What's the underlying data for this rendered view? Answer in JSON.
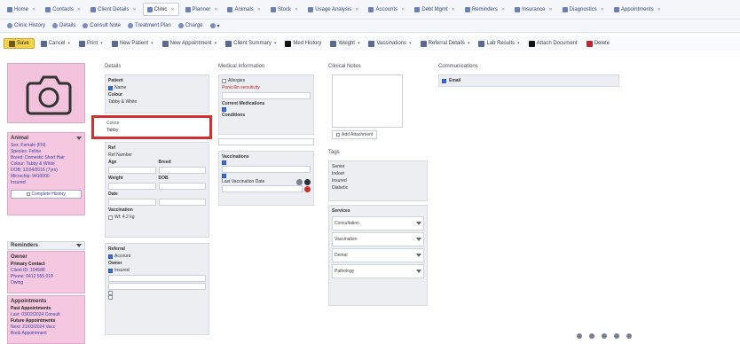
{
  "tabs": [
    {
      "label": "Home",
      "active": false
    },
    {
      "label": "Contacts",
      "active": false
    },
    {
      "label": "Client Details",
      "active": false
    },
    {
      "label": "Clinic",
      "active": true
    },
    {
      "label": "Planner",
      "active": false
    },
    {
      "label": "Animals",
      "active": false
    },
    {
      "label": "Stock",
      "active": false
    },
    {
      "label": "Usage Analysis",
      "active": false
    },
    {
      "label": "Accounts",
      "active": false
    },
    {
      "label": "Debt Mgmt",
      "active": false
    },
    {
      "label": "Reminders",
      "active": false
    },
    {
      "label": "Insurance",
      "active": false
    },
    {
      "label": "Diagnostics",
      "active": false
    },
    {
      "label": "Appointments",
      "active": false
    }
  ],
  "breadcrumbs": [
    "Clinic History",
    "Details",
    "Consult Note",
    "Treatment Plan",
    "Charge",
    "▾"
  ],
  "toolbar": [
    {
      "label": "Save",
      "kind": "save"
    },
    {
      "label": "Cancel",
      "kind": "dd"
    },
    {
      "label": "Print",
      "kind": "dd"
    },
    {
      "label": "New Patient",
      "kind": "dd"
    },
    {
      "label": "New Appointment",
      "kind": "dd"
    },
    {
      "label": "Client Summary",
      "kind": "dd"
    },
    {
      "label": "Med History",
      "kind": "dark"
    },
    {
      "label": "Weight",
      "kind": "dd"
    },
    {
      "label": "Vaccinations",
      "kind": "dd"
    },
    {
      "label": "Referral Details",
      "kind": "dd"
    },
    {
      "label": "Lab Results",
      "kind": "dd"
    },
    {
      "label": "Attach Document",
      "kind": "dark"
    },
    {
      "label": "Delete",
      "kind": "red"
    }
  ],
  "sidebar": {
    "animal": {
      "title": "Animal",
      "lines": [
        "Sex: Female (FN)",
        "Species: Feline",
        "Breed: Domestic Short Hair",
        "Colour: Tabby & White",
        "DOB: 12/04/2016 (7yrs)",
        "Microchip: 9410000",
        "Insured"
      ],
      "link": "Complete History"
    },
    "reminders": {
      "title": "Reminders"
    },
    "owner": {
      "title": "Owner",
      "lines": [
        "Primary Contact",
        "Client ID: 104588",
        "Phone: 0412 555 019",
        "Owing"
      ]
    },
    "appointments": {
      "title": "Appointments",
      "lines": [
        "Past Appointments",
        "Last: 03/02/2024 Consult",
        "Future Appointments",
        "Next: 21/03/2024 Vacc",
        "Book Appointment"
      ]
    }
  },
  "details": {
    "heading": "Details",
    "lines": [
      "Patient",
      "Name",
      "Colour",
      "Tabby & White",
      "Ref",
      "Ref Number",
      "Age",
      "Breed",
      "Weight",
      "DOB",
      "Date",
      "Vaccination",
      "Wt: 4.2 kg",
      "Referral",
      "Account",
      "Owner",
      "Insured"
    ],
    "highlight_label": "Colour",
    "highlight_value": "Tabby"
  },
  "medical": {
    "heading": "Medical Information",
    "lines": [
      "Allergies",
      "Penicillin sensitivity",
      "Current Medications",
      "Conditions",
      "Vaccinations",
      "Last Vaccination Date"
    ]
  },
  "notes": {
    "heading": "Clinical Notes",
    "add_label": "Add Attachment",
    "tags_heading": "Tags",
    "tags": [
      "Senior",
      "Indoor",
      "Insured",
      "Diabetic"
    ],
    "services_heading": "Services",
    "services": [
      "Consultation",
      "Vaccination",
      "Dental",
      "Pathology"
    ]
  },
  "comm": {
    "heading": "Communications",
    "item": "Email"
  }
}
